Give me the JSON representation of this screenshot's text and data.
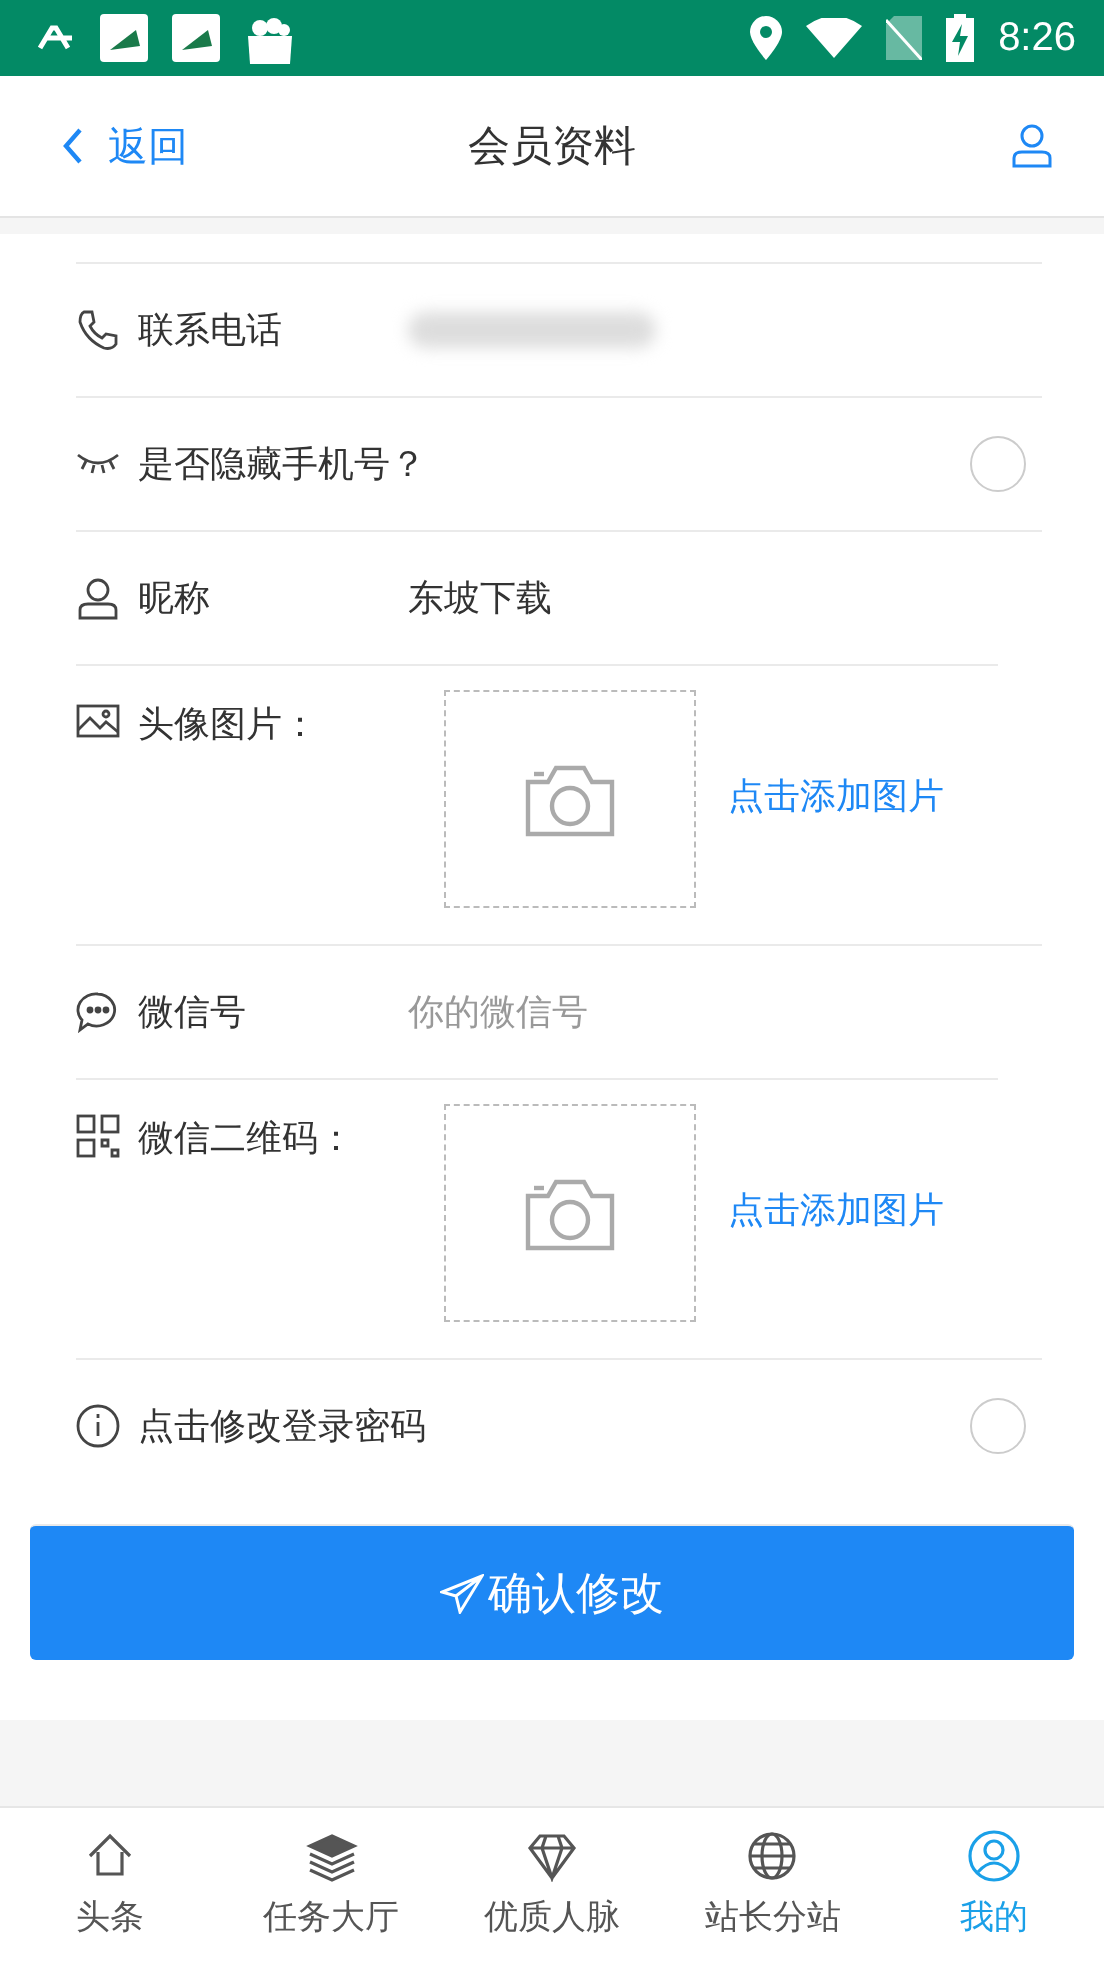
{
  "status_bar": {
    "time": "8:26"
  },
  "header": {
    "back": "返回",
    "title": "会员资料"
  },
  "rows": [
    {
      "kind": "blurred",
      "label": "联系电话"
    },
    {
      "kind": "radio",
      "label": "是否隐藏手机号？",
      "checked": false
    },
    {
      "kind": "value",
      "label": "昵称",
      "value": "东坡下载"
    },
    {
      "kind": "image",
      "label": "头像图片：",
      "action": "点击添加图片"
    },
    {
      "kind": "input",
      "label": "微信号",
      "placeholder": "你的微信号"
    },
    {
      "kind": "image",
      "label": "微信二维码：",
      "action": "点击添加图片"
    },
    {
      "kind": "radio",
      "label": "点击修改登录密码",
      "checked": false
    }
  ],
  "submit": "确认修改",
  "tabs": [
    {
      "label": "头条",
      "selected": false
    },
    {
      "label": "任务大厅",
      "selected": false
    },
    {
      "label": "优质人脉",
      "selected": false
    },
    {
      "label": "站长分站",
      "selected": false
    },
    {
      "label": "我的",
      "selected": true
    }
  ]
}
